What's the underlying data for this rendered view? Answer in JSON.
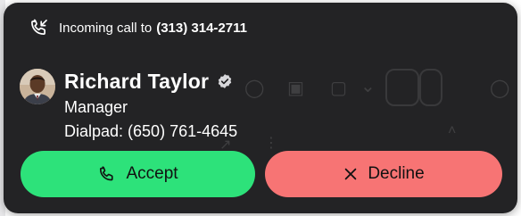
{
  "call": {
    "header_prefix": "Incoming call to",
    "header_number": "(313) 314-2711"
  },
  "caller": {
    "name": "Richard Taylor",
    "role": "Manager",
    "dialpad": "Dialpad: (650) 761-4645"
  },
  "actions": {
    "accept_label": "Accept",
    "decline_label": "Decline"
  },
  "icons": {
    "header": "incoming-call-icon",
    "verified": "verified-check-icon",
    "accept": "phone-icon",
    "decline": "close-icon"
  },
  "colors": {
    "overlay": "#121214",
    "accept": "#2de27a",
    "decline": "#f77474"
  }
}
